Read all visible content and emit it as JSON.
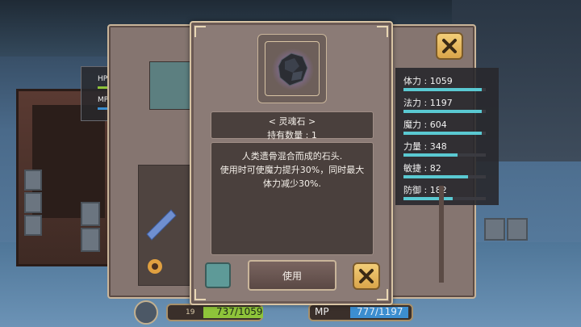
{
  "status": {
    "hp_text": "HP : 737/1059",
    "mp_text": "MP : 777/1197",
    "hp_fraction": 0.696,
    "mp_fraction": 0.649
  },
  "stats": [
    {
      "label": "体力 : 1059",
      "fraction": 0.95
    },
    {
      "label": "法力 : 1197",
      "fraction": 0.95
    },
    {
      "label": "魔力 : 604",
      "fraction": 0.95
    },
    {
      "label": "力量 : 348",
      "fraction": 0.66
    },
    {
      "label": "敏捷 : 82",
      "fraction": 0.78
    },
    {
      "label": "防御 : 182",
      "fraction": 0.6
    }
  ],
  "item": {
    "name": "< 灵魂石 >",
    "quantity": "持有数量 : 1",
    "description_lines": [
      "人类遗骨混合而成的石头.",
      "使用时可使魔力提升30%，同时最大",
      "体力减少30%."
    ]
  },
  "dialog": {
    "use_label": "使用"
  },
  "hud": {
    "hp_value": "737/1059",
    "mp_label": "MP",
    "mp_value": "777/1197",
    "level_text": "19"
  },
  "colors": {
    "hp_bar": "#8ec43a",
    "mp_bar": "#3c8ed0",
    "stat_bar": "#5ac9d2",
    "close_button": "#f2cd78",
    "panel": "#8b7b76"
  },
  "icons": {
    "close": "close-icon",
    "item": "soul-stone-icon",
    "settings": "gear-icon"
  }
}
